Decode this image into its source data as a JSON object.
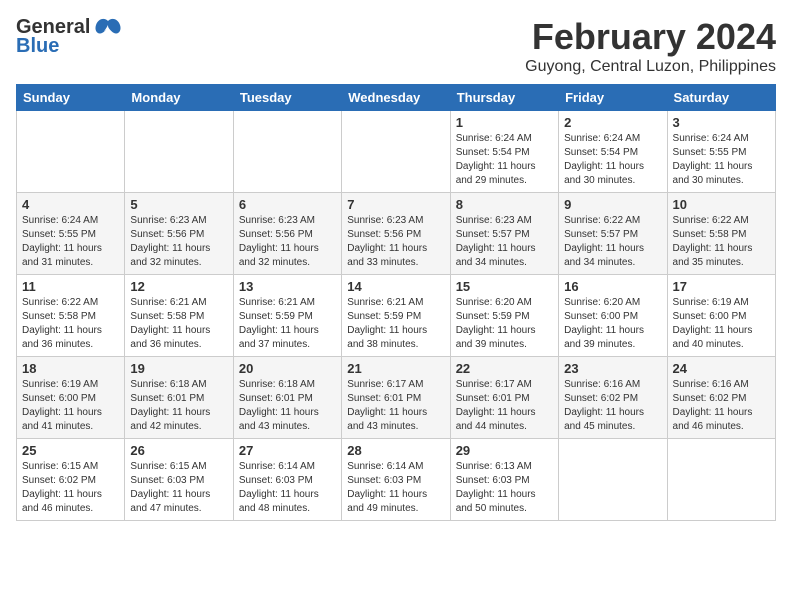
{
  "header": {
    "logo_general": "General",
    "logo_blue": "Blue",
    "month_year": "February 2024",
    "location": "Guyong, Central Luzon, Philippines"
  },
  "days_of_week": [
    "Sunday",
    "Monday",
    "Tuesday",
    "Wednesday",
    "Thursday",
    "Friday",
    "Saturday"
  ],
  "weeks": [
    [
      {
        "day": "",
        "info": ""
      },
      {
        "day": "",
        "info": ""
      },
      {
        "day": "",
        "info": ""
      },
      {
        "day": "",
        "info": ""
      },
      {
        "day": "1",
        "info": "Sunrise: 6:24 AM\nSunset: 5:54 PM\nDaylight: 11 hours\nand 29 minutes."
      },
      {
        "day": "2",
        "info": "Sunrise: 6:24 AM\nSunset: 5:54 PM\nDaylight: 11 hours\nand 30 minutes."
      },
      {
        "day": "3",
        "info": "Sunrise: 6:24 AM\nSunset: 5:55 PM\nDaylight: 11 hours\nand 30 minutes."
      }
    ],
    [
      {
        "day": "4",
        "info": "Sunrise: 6:24 AM\nSunset: 5:55 PM\nDaylight: 11 hours\nand 31 minutes."
      },
      {
        "day": "5",
        "info": "Sunrise: 6:23 AM\nSunset: 5:56 PM\nDaylight: 11 hours\nand 32 minutes."
      },
      {
        "day": "6",
        "info": "Sunrise: 6:23 AM\nSunset: 5:56 PM\nDaylight: 11 hours\nand 32 minutes."
      },
      {
        "day": "7",
        "info": "Sunrise: 6:23 AM\nSunset: 5:56 PM\nDaylight: 11 hours\nand 33 minutes."
      },
      {
        "day": "8",
        "info": "Sunrise: 6:23 AM\nSunset: 5:57 PM\nDaylight: 11 hours\nand 34 minutes."
      },
      {
        "day": "9",
        "info": "Sunrise: 6:22 AM\nSunset: 5:57 PM\nDaylight: 11 hours\nand 34 minutes."
      },
      {
        "day": "10",
        "info": "Sunrise: 6:22 AM\nSunset: 5:58 PM\nDaylight: 11 hours\nand 35 minutes."
      }
    ],
    [
      {
        "day": "11",
        "info": "Sunrise: 6:22 AM\nSunset: 5:58 PM\nDaylight: 11 hours\nand 36 minutes."
      },
      {
        "day": "12",
        "info": "Sunrise: 6:21 AM\nSunset: 5:58 PM\nDaylight: 11 hours\nand 36 minutes."
      },
      {
        "day": "13",
        "info": "Sunrise: 6:21 AM\nSunset: 5:59 PM\nDaylight: 11 hours\nand 37 minutes."
      },
      {
        "day": "14",
        "info": "Sunrise: 6:21 AM\nSunset: 5:59 PM\nDaylight: 11 hours\nand 38 minutes."
      },
      {
        "day": "15",
        "info": "Sunrise: 6:20 AM\nSunset: 5:59 PM\nDaylight: 11 hours\nand 39 minutes."
      },
      {
        "day": "16",
        "info": "Sunrise: 6:20 AM\nSunset: 6:00 PM\nDaylight: 11 hours\nand 39 minutes."
      },
      {
        "day": "17",
        "info": "Sunrise: 6:19 AM\nSunset: 6:00 PM\nDaylight: 11 hours\nand 40 minutes."
      }
    ],
    [
      {
        "day": "18",
        "info": "Sunrise: 6:19 AM\nSunset: 6:00 PM\nDaylight: 11 hours\nand 41 minutes."
      },
      {
        "day": "19",
        "info": "Sunrise: 6:18 AM\nSunset: 6:01 PM\nDaylight: 11 hours\nand 42 minutes."
      },
      {
        "day": "20",
        "info": "Sunrise: 6:18 AM\nSunset: 6:01 PM\nDaylight: 11 hours\nand 43 minutes."
      },
      {
        "day": "21",
        "info": "Sunrise: 6:17 AM\nSunset: 6:01 PM\nDaylight: 11 hours\nand 43 minutes."
      },
      {
        "day": "22",
        "info": "Sunrise: 6:17 AM\nSunset: 6:01 PM\nDaylight: 11 hours\nand 44 minutes."
      },
      {
        "day": "23",
        "info": "Sunrise: 6:16 AM\nSunset: 6:02 PM\nDaylight: 11 hours\nand 45 minutes."
      },
      {
        "day": "24",
        "info": "Sunrise: 6:16 AM\nSunset: 6:02 PM\nDaylight: 11 hours\nand 46 minutes."
      }
    ],
    [
      {
        "day": "25",
        "info": "Sunrise: 6:15 AM\nSunset: 6:02 PM\nDaylight: 11 hours\nand 46 minutes."
      },
      {
        "day": "26",
        "info": "Sunrise: 6:15 AM\nSunset: 6:03 PM\nDaylight: 11 hours\nand 47 minutes."
      },
      {
        "day": "27",
        "info": "Sunrise: 6:14 AM\nSunset: 6:03 PM\nDaylight: 11 hours\nand 48 minutes."
      },
      {
        "day": "28",
        "info": "Sunrise: 6:14 AM\nSunset: 6:03 PM\nDaylight: 11 hours\nand 49 minutes."
      },
      {
        "day": "29",
        "info": "Sunrise: 6:13 AM\nSunset: 6:03 PM\nDaylight: 11 hours\nand 50 minutes."
      },
      {
        "day": "",
        "info": ""
      },
      {
        "day": "",
        "info": ""
      }
    ]
  ]
}
